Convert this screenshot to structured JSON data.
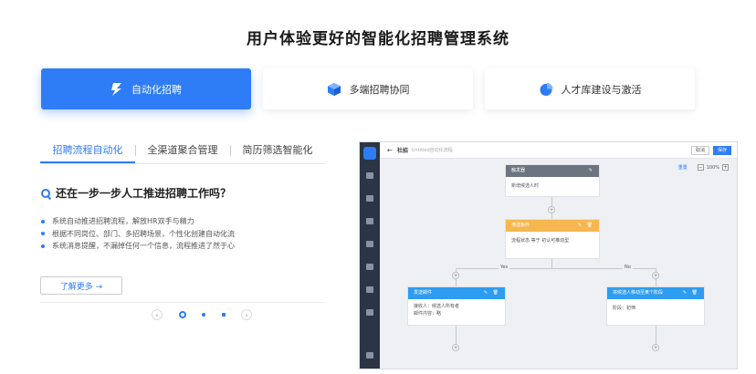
{
  "page": {
    "title": "用户体验更好的智能化招聘管理系统"
  },
  "features": [
    {
      "label": "自动化招聘",
      "icon": "bolt-icon",
      "active": true
    },
    {
      "label": "多端招聘协同",
      "icon": "cube-icon",
      "active": false
    },
    {
      "label": "人才库建设与激活",
      "icon": "pie-chart-icon",
      "active": false
    }
  ],
  "subtabs": [
    {
      "label": "招聘流程自动化",
      "active": true
    },
    {
      "label": "全渠道聚合管理",
      "active": false
    },
    {
      "label": "简历筛选智能化",
      "active": false
    }
  ],
  "content": {
    "question": "还在一步一步人工推进招聘工作吗？",
    "bullets": [
      "系统自动推进招聘流程，解放HR双手与精力",
      "根据不同岗位、部门、多招聘场景，个性化创建自动化流",
      "系统消息提醒，不漏掉任何一个信息，流程推进了然于心"
    ],
    "learn_more": "了解更多 →"
  },
  "pager": {
    "prev": "‹",
    "next": "›"
  },
  "screenshot": {
    "back": "←",
    "breadcrumb": "社招",
    "sub": "Untitled自动化流程",
    "cancel": "取消",
    "save": "保存",
    "zoom_reset": "重置",
    "zoom_level": "100%",
    "zoom_minus": "−",
    "zoom_plus": "+",
    "plus": "+",
    "nodes": {
      "start": {
        "title": "触发器",
        "body": "新增候选人时",
        "ops": "✎"
      },
      "cond": {
        "title": "筛选条件",
        "body": "流程状态 等于 初认可推动型",
        "ops": "✎ 🗑"
      },
      "left": {
        "title": "发送邮件",
        "body_1": "接收人：候选人所有者",
        "body_2": "邮件内容：略",
        "ops": "✎ 🗑"
      },
      "right": {
        "title": "将候选人移动至某个阶段",
        "body": "阶段：初筛",
        "ops": "✎ 🗑"
      }
    },
    "yes": "Yes",
    "no": "No"
  },
  "colors": {
    "accent": "#2e7cf6",
    "sidebar": "#2b3545",
    "condition": "#f5b74e",
    "action": "#2e9cf0",
    "trigger": "#6c7480"
  }
}
